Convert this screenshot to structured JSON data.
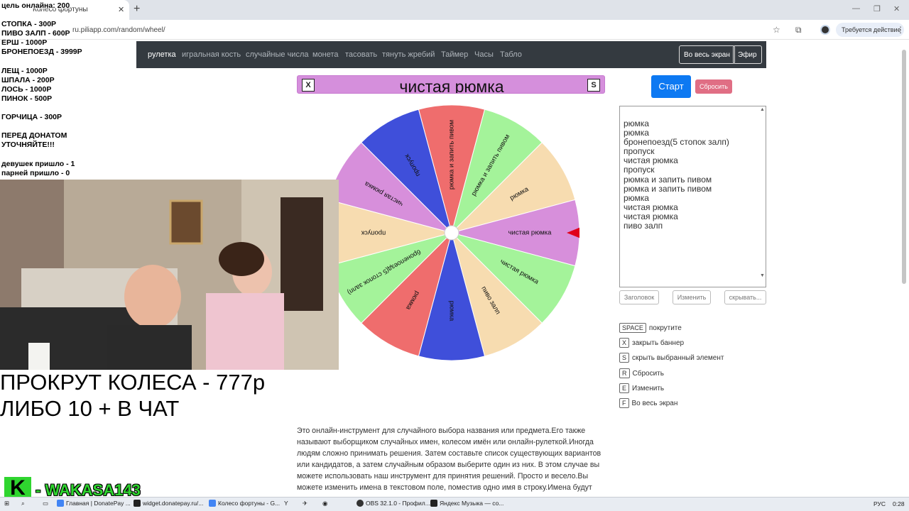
{
  "browser": {
    "tab_title": "Колесо фортуны",
    "url": "ru.piliapp.com/random/wheel/",
    "action_label": "Требуется действие"
  },
  "nav": {
    "items": [
      "рулетка",
      "игральная кость",
      "случайные числа",
      "монета",
      "тасовать",
      "тянуть жребий",
      "Таймер",
      "Часы",
      "Табло"
    ],
    "fullscreen_label": "Во весь экран",
    "live_label": "Эфир"
  },
  "banner": {
    "close_key": "X",
    "title": "чистая рюмка",
    "hide_key": "S"
  },
  "wheel": {
    "segments": [
      {
        "label": "рюмка и запить пивом",
        "color": "#ef6d6d"
      },
      {
        "label": "рюмка и запить пивом",
        "color": "#a4f39a"
      },
      {
        "label": "рюмка",
        "color": "#f7dcb0"
      },
      {
        "label": "чистая рюмка",
        "color": "#d78fdb"
      },
      {
        "label": "чистая рюмка",
        "color": "#a4f39a"
      },
      {
        "label": "пиво залп",
        "color": "#f7dcb0"
      },
      {
        "label": "рюмка",
        "color": "#3f4fda"
      },
      {
        "label": "рюмка",
        "color": "#ef6d6d"
      },
      {
        "label": "бронепоезд(5 стопок залп)",
        "color": "#a4f39a"
      },
      {
        "label": "пропуск",
        "color": "#f7dcb0"
      },
      {
        "label": "чистая рюмка",
        "color": "#d78fdb"
      },
      {
        "label": "пропуск",
        "color": "#3f4fda"
      }
    ],
    "pointer_color": "#e0001a"
  },
  "controls": {
    "start_label": "Старт",
    "reset_label": "Сбросить",
    "names": [
      "рюмка",
      "рюмка",
      "бронепоезд(5 стопок залп)",
      "пропуск",
      "чистая рюмка",
      "пропуск",
      "рюмка и запить пивом",
      "рюмка и запить пивом",
      "рюмка",
      "чистая рюмка",
      "чистая рюмка",
      "пиво залп"
    ],
    "title_btn": "Заголовок",
    "edit_btn": "Изменить",
    "hide_btn": "скрывать..."
  },
  "shortcuts": [
    {
      "key": "SPACE",
      "label": "покрутите"
    },
    {
      "key": "X",
      "label": "закрыть баннер"
    },
    {
      "key": "S",
      "label": "скрыть выбранный элемент"
    },
    {
      "key": "R",
      "label": "Сбросить"
    },
    {
      "key": "E",
      "label": "Изменить"
    },
    {
      "key": "F",
      "label": "Во весь экран"
    }
  ],
  "description": "Это онлайн-инструмент для случайного выбора названия или предмета.Его также называют выборщиком случайных имен, колесом имён или онлайн-рулеткой.Иногда людям сложно принимать решения. Затем составьте список существующих вариантов или кандидатов, а затем случайным образом выберите один из них. В этом случае вы можете использовать наш инструмент для принятия решений. Просто и весело.Вы можете изменить имена в текстовом поле, поместив одно имя в строку.Имена будут",
  "overlay": {
    "lines": [
      "цель онлайна: 200",
      "СТОПКА - 300Р",
      "ПИВО ЗАЛП - 600Р",
      "ЕРШ - 1000Р",
      "БРОНЕПОЕЗД - 3999Р",
      "ЛЕЩ - 1000Р",
      "ШПАЛА - 200Р",
      "ЛОСЬ - 1000Р",
      "ПИНОК - 500Р",
      "ГОРЧИЦА - 300Р",
      "ПЕРЕД ДОНАТОМ",
      "УТОЧНЯЙТЕ!!!",
      "девушек пришло - 1",
      "парней пришло - 0"
    ],
    "promo_line1": "ПРОКРУТ КОЛЕСА - 777р",
    "promo_line2": "ЛИБО 10 + В ЧАТ",
    "brand_letter": "K",
    "brand_name": "- WAKASA143"
  },
  "taskbar": {
    "items": [
      "Главная | DonatePay ...",
      "widget.donatepay.ru/...",
      "Колесо фортуны - G...",
      "OBS 32.1.0 - Профил...",
      "Яндекс Музыка — со..."
    ],
    "lang": "РУС",
    "time": "0:28"
  }
}
